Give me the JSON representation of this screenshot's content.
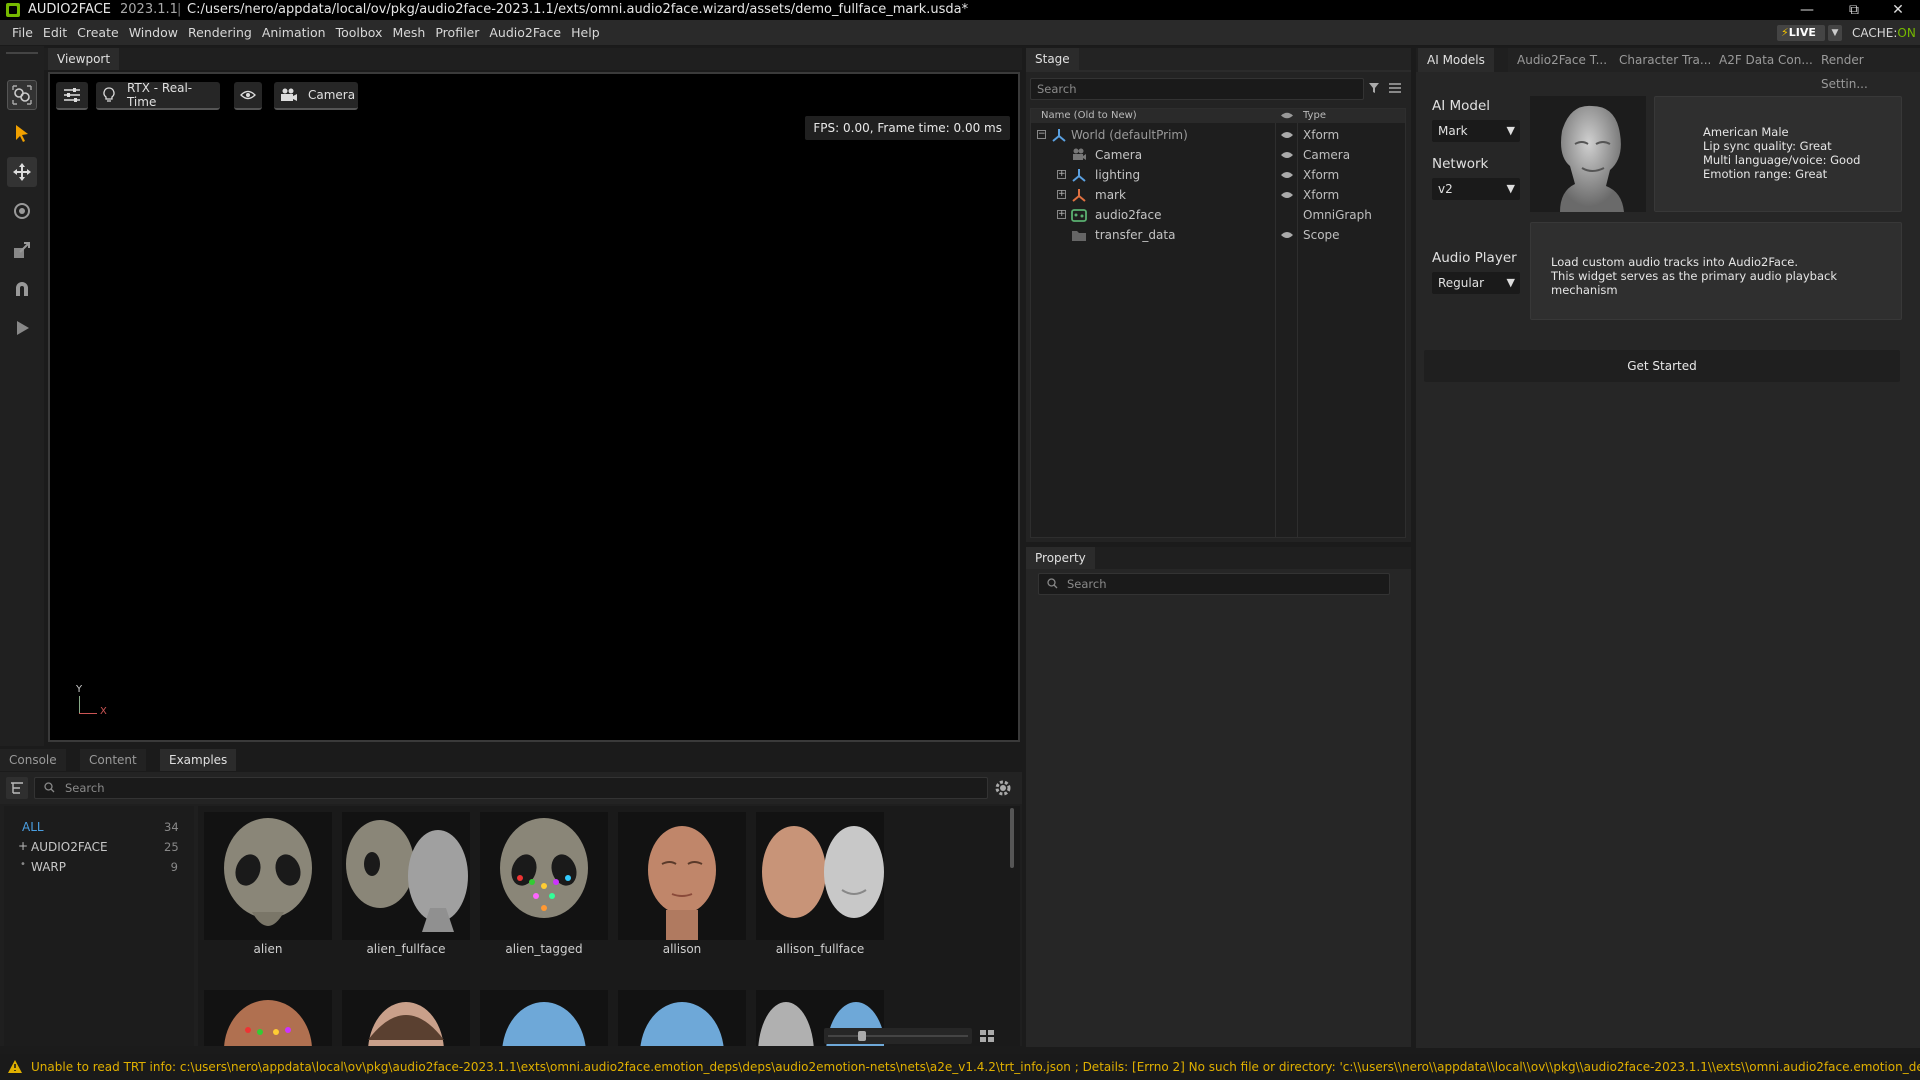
{
  "titlebar": {
    "app_name": "AUDIO2FACE",
    "version": "2023.1.1",
    "separator": "|",
    "file_path": "C:/users/nero/appdata/local/ov/pkg/audio2face-2023.1.1/exts/omni.audio2face.wizard/assets/demo_fullface_mark.usda*"
  },
  "menu": [
    "File",
    "Edit",
    "Create",
    "Window",
    "Rendering",
    "Animation",
    "Toolbox",
    "Mesh",
    "Profiler",
    "Audio2Face",
    "Help"
  ],
  "live": {
    "label": "LIVE",
    "cache_label": "CACHE:",
    "cache_state": "ON"
  },
  "viewport": {
    "tab": "Viewport",
    "render_mode": "RTX - Real-Time",
    "camera": "Camera",
    "fps_text": "FPS: 0.00, Frame time: 0.00 ms",
    "axis_y": "Y",
    "axis_x": "X"
  },
  "stage": {
    "tab": "Stage",
    "search_placeholder": "Search",
    "col_name": "Name (Old to New)",
    "col_type": "Type",
    "rows": [
      {
        "name": "World (defaultPrim)",
        "type": "Xform"
      },
      {
        "name": "Camera",
        "type": "Camera"
      },
      {
        "name": "lighting",
        "type": "Xform"
      },
      {
        "name": "mark",
        "type": "Xform"
      },
      {
        "name": "audio2face",
        "type": "OmniGraph"
      },
      {
        "name": "transfer_data",
        "type": "Scope"
      }
    ]
  },
  "property": {
    "tab": "Property",
    "search_placeholder": "Search"
  },
  "right_tabs": [
    "AI Models",
    "Audio2Face T...",
    "Character Tra...",
    "A2F Data Con...",
    "Render Settin..."
  ],
  "ai_models": {
    "ai_model_label": "AI Model",
    "ai_model_value": "Mark",
    "network_label": "Network",
    "network_value": "v2",
    "info_lines": [
      "American Male",
      "Lip sync quality: Great",
      "Multi language/voice: Good",
      "Emotion range: Great"
    ],
    "audio_player_label": "Audio Player",
    "audio_player_value": "Regular",
    "audio_info_lines": [
      "Load custom audio tracks into Audio2Face.",
      "This widget serves as the primary audio playback mechanism"
    ],
    "get_started": "Get Started"
  },
  "bottom": {
    "tabs": [
      "Console",
      "Content",
      "Examples"
    ],
    "search_placeholder": "Search",
    "categories": [
      {
        "name": "ALL",
        "count": "34"
      },
      {
        "name": "AUDIO2FACE",
        "count": "25"
      },
      {
        "name": "WARP",
        "count": "9"
      }
    ],
    "thumbnails": [
      "alien",
      "alien_fullface",
      "alien_tagged",
      "allison",
      "allison_fullface"
    ]
  },
  "status": {
    "message": "Unable to read TRT info: c:\\users\\nero\\appdata\\local\\ov\\pkg\\audio2face-2023.1.1\\exts\\omni.audio2face.emotion_deps\\deps\\audio2emotion-nets\\nets\\a2e_v1.4.2\\trt_info.json ; Details: [Errno 2] No such file or directory: 'c:\\\\users\\\\nero\\\\appdata\\\\local\\\\ov\\\\pkg\\\\audio2face-2023.1.1\\\\exts\\\\omni.audio2face.emotion_deps\\\\deps\\\\audio2emotion-"
  }
}
